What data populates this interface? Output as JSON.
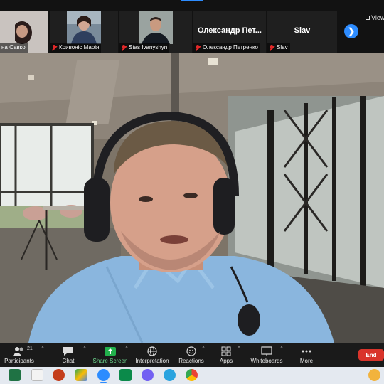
{
  "participants_strip": {
    "tiles": [
      {
        "name": "на Савко",
        "muted": false
      },
      {
        "name": "Кривоніс Марія",
        "muted": true
      },
      {
        "name": "Stas Ivanyshyn",
        "muted": true
      },
      {
        "name": "Олександр Петренко",
        "title": "Олександр Пет...",
        "muted": true
      },
      {
        "name": "Slav",
        "title": "Slav",
        "muted": true
      }
    ],
    "view_label": "View",
    "next_arrow": "❯"
  },
  "toolbar": {
    "participants_label": "Participants",
    "participants_count": "21",
    "chat_label": "Chat",
    "share_label": "Share Screen",
    "interpretation_label": "Interpretation",
    "reactions_label": "Reactions",
    "apps_label": "Apps",
    "whiteboards_label": "Whiteboards",
    "more_label": "More",
    "end_label": "End"
  },
  "taskbar": {
    "icons": [
      "excel-icon",
      "files-icon",
      "powerpoint-icon",
      "meet-icon",
      "zoom-icon",
      "kaspersky-icon",
      "viber-icon",
      "telegram-icon",
      "chrome-icon",
      "weather-icon"
    ]
  },
  "colors": {
    "accent": "#2d8cff",
    "end": "#d9342b",
    "share_green": "#22b14c"
  }
}
